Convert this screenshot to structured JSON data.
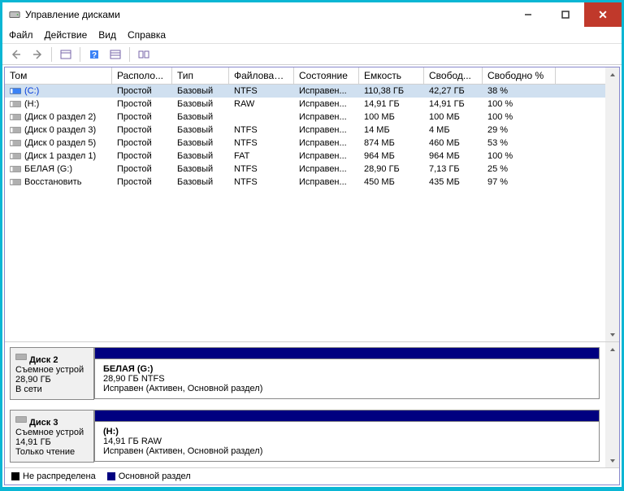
{
  "title": "Управление дисками",
  "menu": {
    "file": "Файл",
    "action": "Действие",
    "view": "Вид",
    "help": "Справка"
  },
  "columns": [
    "Том",
    "Располо...",
    "Тип",
    "Файловая с...",
    "Состояние",
    "Емкость",
    "Свобод...",
    "Свободно %"
  ],
  "volumes": [
    {
      "name": "(C:)",
      "layout": "Простой",
      "type": "Базовый",
      "fs": "NTFS",
      "status": "Исправен...",
      "capacity": "110,38 ГБ",
      "free": "42,27 ГБ",
      "pct": "38 %",
      "sel": true
    },
    {
      "name": "(H:)",
      "layout": "Простой",
      "type": "Базовый",
      "fs": "RAW",
      "status": "Исправен...",
      "capacity": "14,91 ГБ",
      "free": "14,91 ГБ",
      "pct": "100 %"
    },
    {
      "name": "(Диск 0 раздел 2)",
      "layout": "Простой",
      "type": "Базовый",
      "fs": "",
      "status": "Исправен...",
      "capacity": "100 МБ",
      "free": "100 МБ",
      "pct": "100 %"
    },
    {
      "name": "(Диск 0 раздел 3)",
      "layout": "Простой",
      "type": "Базовый",
      "fs": "NTFS",
      "status": "Исправен...",
      "capacity": "14 МБ",
      "free": "4 МБ",
      "pct": "29 %"
    },
    {
      "name": "(Диск 0 раздел 5)",
      "layout": "Простой",
      "type": "Базовый",
      "fs": "NTFS",
      "status": "Исправен...",
      "capacity": "874 МБ",
      "free": "460 МБ",
      "pct": "53 %"
    },
    {
      "name": "(Диск 1 раздел 1)",
      "layout": "Простой",
      "type": "Базовый",
      "fs": "FAT",
      "status": "Исправен...",
      "capacity": "964 МБ",
      "free": "964 МБ",
      "pct": "100 %"
    },
    {
      "name": "БЕЛАЯ (G:)",
      "layout": "Простой",
      "type": "Базовый",
      "fs": "NTFS",
      "status": "Исправен...",
      "capacity": "28,90 ГБ",
      "free": "7,13 ГБ",
      "pct": "25 %"
    },
    {
      "name": "Восстановить",
      "layout": "Простой",
      "type": "Базовый",
      "fs": "NTFS",
      "status": "Исправен...",
      "capacity": "450 МБ",
      "free": "435 МБ",
      "pct": "97 %"
    }
  ],
  "disks": [
    {
      "name": "Диск 2",
      "type": "Съемное устрой",
      "size": "28,90 ГБ",
      "status": "В сети",
      "partition": {
        "name": "БЕЛАЯ  (G:)",
        "info": "28,90 ГБ NTFS",
        "status": "Исправен (Активен, Основной раздел)"
      }
    },
    {
      "name": "Диск 3",
      "type": "Съемное устрой",
      "size": "14,91 ГБ",
      "status": "Только чтение",
      "partition": {
        "name": "(H:)",
        "info": "14,91 ГБ RAW",
        "status": "Исправен (Активен, Основной раздел)"
      }
    }
  ],
  "legend": {
    "unalloc": "Не распределена",
    "primary": "Основной раздел"
  }
}
